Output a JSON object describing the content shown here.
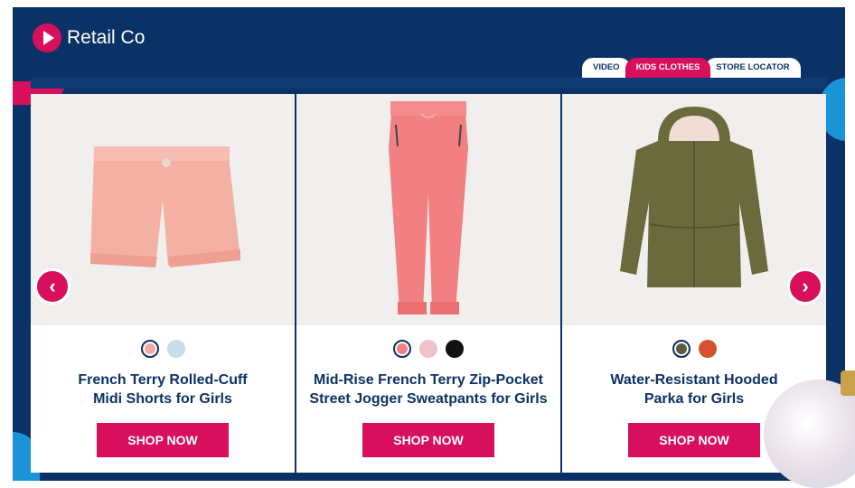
{
  "brand": {
    "name": "Retail Co",
    "accent": "#d80f5c",
    "navy": "#0b3266"
  },
  "tabs": [
    {
      "label": "VIDEO",
      "active": false
    },
    {
      "label": "KIDS CLOTHES",
      "active": true
    },
    {
      "label": "STORE LOCATOR",
      "active": false
    }
  ],
  "carousel": {
    "prev_icon": "chevron-left-icon",
    "next_icon": "chevron-right-icon"
  },
  "products": [
    {
      "title_line1": "French Terry Rolled-Cuff",
      "title_line2": "Midi Shorts for Girls",
      "cta": "SHOP NOW",
      "swatches": [
        "#f2a9a1",
        "#c7dde8"
      ]
    },
    {
      "title_line1": "Mid-Rise French Terry Zip-Pocket",
      "title_line2": "Street Jogger Sweatpants for Girls",
      "cta": "SHOP NOW",
      "swatches": [
        "#f07f7f",
        "#eec2c8",
        "#111111"
      ]
    },
    {
      "title_line1": "Water-Resistant Hooded",
      "title_line2": "Parka for Girls",
      "cta": "SHOP NOW",
      "swatches": [
        "#5f5a3a",
        "#d4502e"
      ]
    }
  ]
}
